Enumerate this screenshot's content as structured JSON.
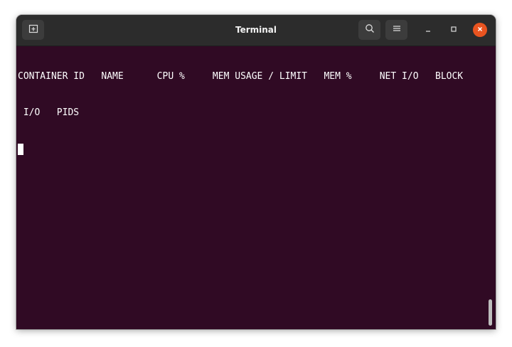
{
  "window": {
    "title": "Terminal"
  },
  "titlebar": {
    "new_tab_icon": "new-tab-icon",
    "search_icon": "search-icon",
    "menu_icon": "hamburger-menu-icon",
    "minimize_icon": "minimize-icon",
    "maximize_icon": "maximize-icon",
    "close_icon": "close-icon"
  },
  "terminal": {
    "lines": [
      "CONTAINER ID   NAME      CPU %     MEM USAGE / LIMIT   MEM %     NET I/O   BLOCK",
      " I/O   PIDS"
    ],
    "background": "#300a24",
    "foreground": "#ffffff"
  },
  "colors": {
    "titlebar": "#2c2c2c",
    "close_accent": "#e95420"
  }
}
